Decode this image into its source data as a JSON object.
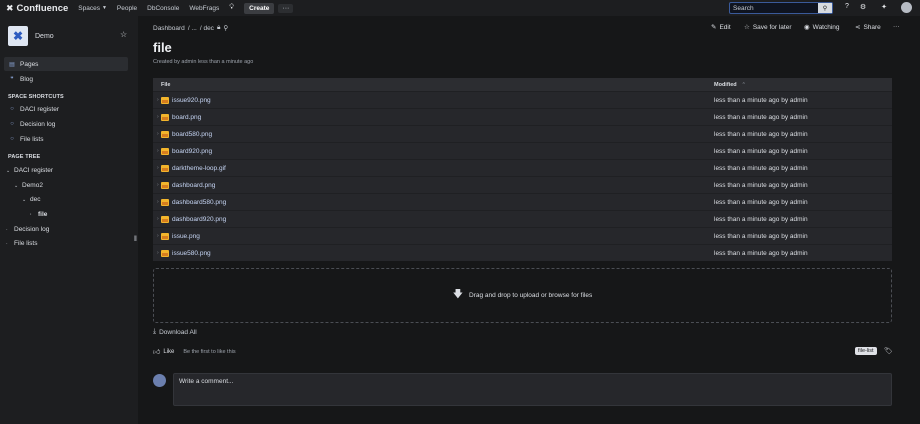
{
  "topnav": {
    "logo_text": "Confluence",
    "items": [
      {
        "label": "Spaces",
        "has_dropdown": true
      },
      {
        "label": "People"
      },
      {
        "label": "DbConsole"
      },
      {
        "label": "WebFrags"
      }
    ],
    "create_label": "Create",
    "more_label": "···",
    "search_placeholder": "Search"
  },
  "sidebar": {
    "space_name": "Demo",
    "nav": [
      {
        "label": "Pages",
        "icon": "page-icon"
      },
      {
        "label": "Blog",
        "icon": "quote-icon"
      }
    ],
    "shortcuts_heading": "SPACE SHORTCUTS",
    "shortcuts": [
      "DACI register",
      "Decision log",
      "File lists"
    ],
    "tree_heading": "PAGE TREE",
    "tree": [
      {
        "label": "DACI register",
        "expanded": true
      },
      {
        "label": "Demo2",
        "expanded": true
      },
      {
        "label": "dec",
        "expanded": true
      },
      {
        "label": "file",
        "current": true
      },
      {
        "label": "Decision log"
      },
      {
        "label": "File lists"
      }
    ]
  },
  "page": {
    "breadcrumb": [
      "Dashboard",
      "/ ...",
      "/ dec"
    ],
    "title": "file",
    "byline": "Created by admin less than a minute ago",
    "actions": {
      "edit": "Edit",
      "save_later": "Save for later",
      "watching": "Watching",
      "share": "Share",
      "more": "···"
    }
  },
  "files_table": {
    "columns": [
      "File",
      "Modified"
    ],
    "rows": [
      {
        "name": "issue920.png",
        "modified": "less than a minute ago by admin"
      },
      {
        "name": "board.png",
        "modified": "less than a minute ago by admin"
      },
      {
        "name": "board580.png",
        "modified": "less than a minute ago by admin"
      },
      {
        "name": "board920.png",
        "modified": "less than a minute ago by admin"
      },
      {
        "name": "darktheme-loop.gif",
        "modified": "less than a minute ago by admin"
      },
      {
        "name": "dashboard.png",
        "modified": "less than a minute ago by admin"
      },
      {
        "name": "dashboard580.png",
        "modified": "less than a minute ago by admin"
      },
      {
        "name": "dashboard920.png",
        "modified": "less than a minute ago by admin"
      },
      {
        "name": "issue.png",
        "modified": "less than a minute ago by admin"
      },
      {
        "name": "issue580.png",
        "modified": "less than a minute ago by admin"
      }
    ]
  },
  "dropzone_text": "Drag and drop to upload or browse for files",
  "download_all": "Download All",
  "like": {
    "label": "Like",
    "first_text": "Be the first to like this"
  },
  "labels": [
    "file-list"
  ],
  "comment_placeholder": "Write a comment..."
}
